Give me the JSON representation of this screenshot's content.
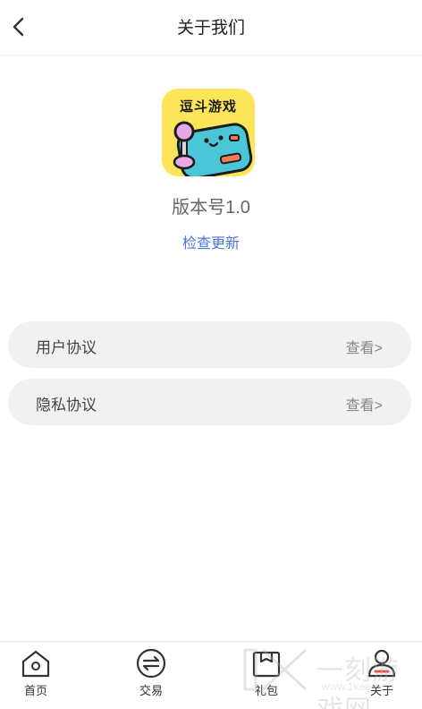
{
  "header": {
    "title": "关于我们"
  },
  "app": {
    "icon_text": "逗斗游戏",
    "version_label": "版本号1.0",
    "check_update_label": "检查更新"
  },
  "menu": {
    "items": [
      {
        "label": "用户协议",
        "action": "查看>"
      },
      {
        "label": "隐私协议",
        "action": "查看>"
      }
    ]
  },
  "tabbar": {
    "tabs": [
      {
        "label": "首页",
        "icon": "home-icon"
      },
      {
        "label": "交易",
        "icon": "exchange-icon"
      },
      {
        "label": "礼包",
        "icon": "gift-icon"
      },
      {
        "label": "关于",
        "icon": "user-icon",
        "active": true
      }
    ]
  },
  "watermark": {
    "main": "一刻游戏网",
    "sub": "www.1kee.com"
  },
  "colors": {
    "accent_link": "#4a74d9",
    "icon_bg": "#fde55a",
    "row_bg": "#f1f1f1",
    "active_indicator": "#e84f4f"
  }
}
